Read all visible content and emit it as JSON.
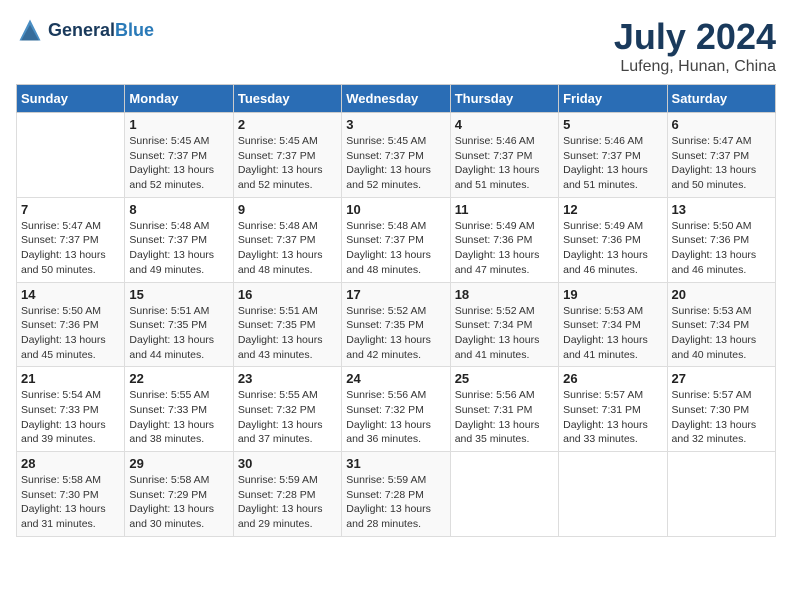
{
  "header": {
    "logo_general": "General",
    "logo_blue": "Blue",
    "title": "July 2024",
    "location": "Lufeng, Hunan, China"
  },
  "days_of_week": [
    "Sunday",
    "Monday",
    "Tuesday",
    "Wednesday",
    "Thursday",
    "Friday",
    "Saturday"
  ],
  "weeks": [
    [
      {
        "day": "",
        "info": ""
      },
      {
        "day": "1",
        "info": "Sunrise: 5:45 AM\nSunset: 7:37 PM\nDaylight: 13 hours\nand 52 minutes."
      },
      {
        "day": "2",
        "info": "Sunrise: 5:45 AM\nSunset: 7:37 PM\nDaylight: 13 hours\nand 52 minutes."
      },
      {
        "day": "3",
        "info": "Sunrise: 5:45 AM\nSunset: 7:37 PM\nDaylight: 13 hours\nand 52 minutes."
      },
      {
        "day": "4",
        "info": "Sunrise: 5:46 AM\nSunset: 7:37 PM\nDaylight: 13 hours\nand 51 minutes."
      },
      {
        "day": "5",
        "info": "Sunrise: 5:46 AM\nSunset: 7:37 PM\nDaylight: 13 hours\nand 51 minutes."
      },
      {
        "day": "6",
        "info": "Sunrise: 5:47 AM\nSunset: 7:37 PM\nDaylight: 13 hours\nand 50 minutes."
      }
    ],
    [
      {
        "day": "7",
        "info": "Sunrise: 5:47 AM\nSunset: 7:37 PM\nDaylight: 13 hours\nand 50 minutes."
      },
      {
        "day": "8",
        "info": "Sunrise: 5:48 AM\nSunset: 7:37 PM\nDaylight: 13 hours\nand 49 minutes."
      },
      {
        "day": "9",
        "info": "Sunrise: 5:48 AM\nSunset: 7:37 PM\nDaylight: 13 hours\nand 48 minutes."
      },
      {
        "day": "10",
        "info": "Sunrise: 5:48 AM\nSunset: 7:37 PM\nDaylight: 13 hours\nand 48 minutes."
      },
      {
        "day": "11",
        "info": "Sunrise: 5:49 AM\nSunset: 7:36 PM\nDaylight: 13 hours\nand 47 minutes."
      },
      {
        "day": "12",
        "info": "Sunrise: 5:49 AM\nSunset: 7:36 PM\nDaylight: 13 hours\nand 46 minutes."
      },
      {
        "day": "13",
        "info": "Sunrise: 5:50 AM\nSunset: 7:36 PM\nDaylight: 13 hours\nand 46 minutes."
      }
    ],
    [
      {
        "day": "14",
        "info": "Sunrise: 5:50 AM\nSunset: 7:36 PM\nDaylight: 13 hours\nand 45 minutes."
      },
      {
        "day": "15",
        "info": "Sunrise: 5:51 AM\nSunset: 7:35 PM\nDaylight: 13 hours\nand 44 minutes."
      },
      {
        "day": "16",
        "info": "Sunrise: 5:51 AM\nSunset: 7:35 PM\nDaylight: 13 hours\nand 43 minutes."
      },
      {
        "day": "17",
        "info": "Sunrise: 5:52 AM\nSunset: 7:35 PM\nDaylight: 13 hours\nand 42 minutes."
      },
      {
        "day": "18",
        "info": "Sunrise: 5:52 AM\nSunset: 7:34 PM\nDaylight: 13 hours\nand 41 minutes."
      },
      {
        "day": "19",
        "info": "Sunrise: 5:53 AM\nSunset: 7:34 PM\nDaylight: 13 hours\nand 41 minutes."
      },
      {
        "day": "20",
        "info": "Sunrise: 5:53 AM\nSunset: 7:34 PM\nDaylight: 13 hours\nand 40 minutes."
      }
    ],
    [
      {
        "day": "21",
        "info": "Sunrise: 5:54 AM\nSunset: 7:33 PM\nDaylight: 13 hours\nand 39 minutes."
      },
      {
        "day": "22",
        "info": "Sunrise: 5:55 AM\nSunset: 7:33 PM\nDaylight: 13 hours\nand 38 minutes."
      },
      {
        "day": "23",
        "info": "Sunrise: 5:55 AM\nSunset: 7:32 PM\nDaylight: 13 hours\nand 37 minutes."
      },
      {
        "day": "24",
        "info": "Sunrise: 5:56 AM\nSunset: 7:32 PM\nDaylight: 13 hours\nand 36 minutes."
      },
      {
        "day": "25",
        "info": "Sunrise: 5:56 AM\nSunset: 7:31 PM\nDaylight: 13 hours\nand 35 minutes."
      },
      {
        "day": "26",
        "info": "Sunrise: 5:57 AM\nSunset: 7:31 PM\nDaylight: 13 hours\nand 33 minutes."
      },
      {
        "day": "27",
        "info": "Sunrise: 5:57 AM\nSunset: 7:30 PM\nDaylight: 13 hours\nand 32 minutes."
      }
    ],
    [
      {
        "day": "28",
        "info": "Sunrise: 5:58 AM\nSunset: 7:30 PM\nDaylight: 13 hours\nand 31 minutes."
      },
      {
        "day": "29",
        "info": "Sunrise: 5:58 AM\nSunset: 7:29 PM\nDaylight: 13 hours\nand 30 minutes."
      },
      {
        "day": "30",
        "info": "Sunrise: 5:59 AM\nSunset: 7:28 PM\nDaylight: 13 hours\nand 29 minutes."
      },
      {
        "day": "31",
        "info": "Sunrise: 5:59 AM\nSunset: 7:28 PM\nDaylight: 13 hours\nand 28 minutes."
      },
      {
        "day": "",
        "info": ""
      },
      {
        "day": "",
        "info": ""
      },
      {
        "day": "",
        "info": ""
      }
    ]
  ]
}
